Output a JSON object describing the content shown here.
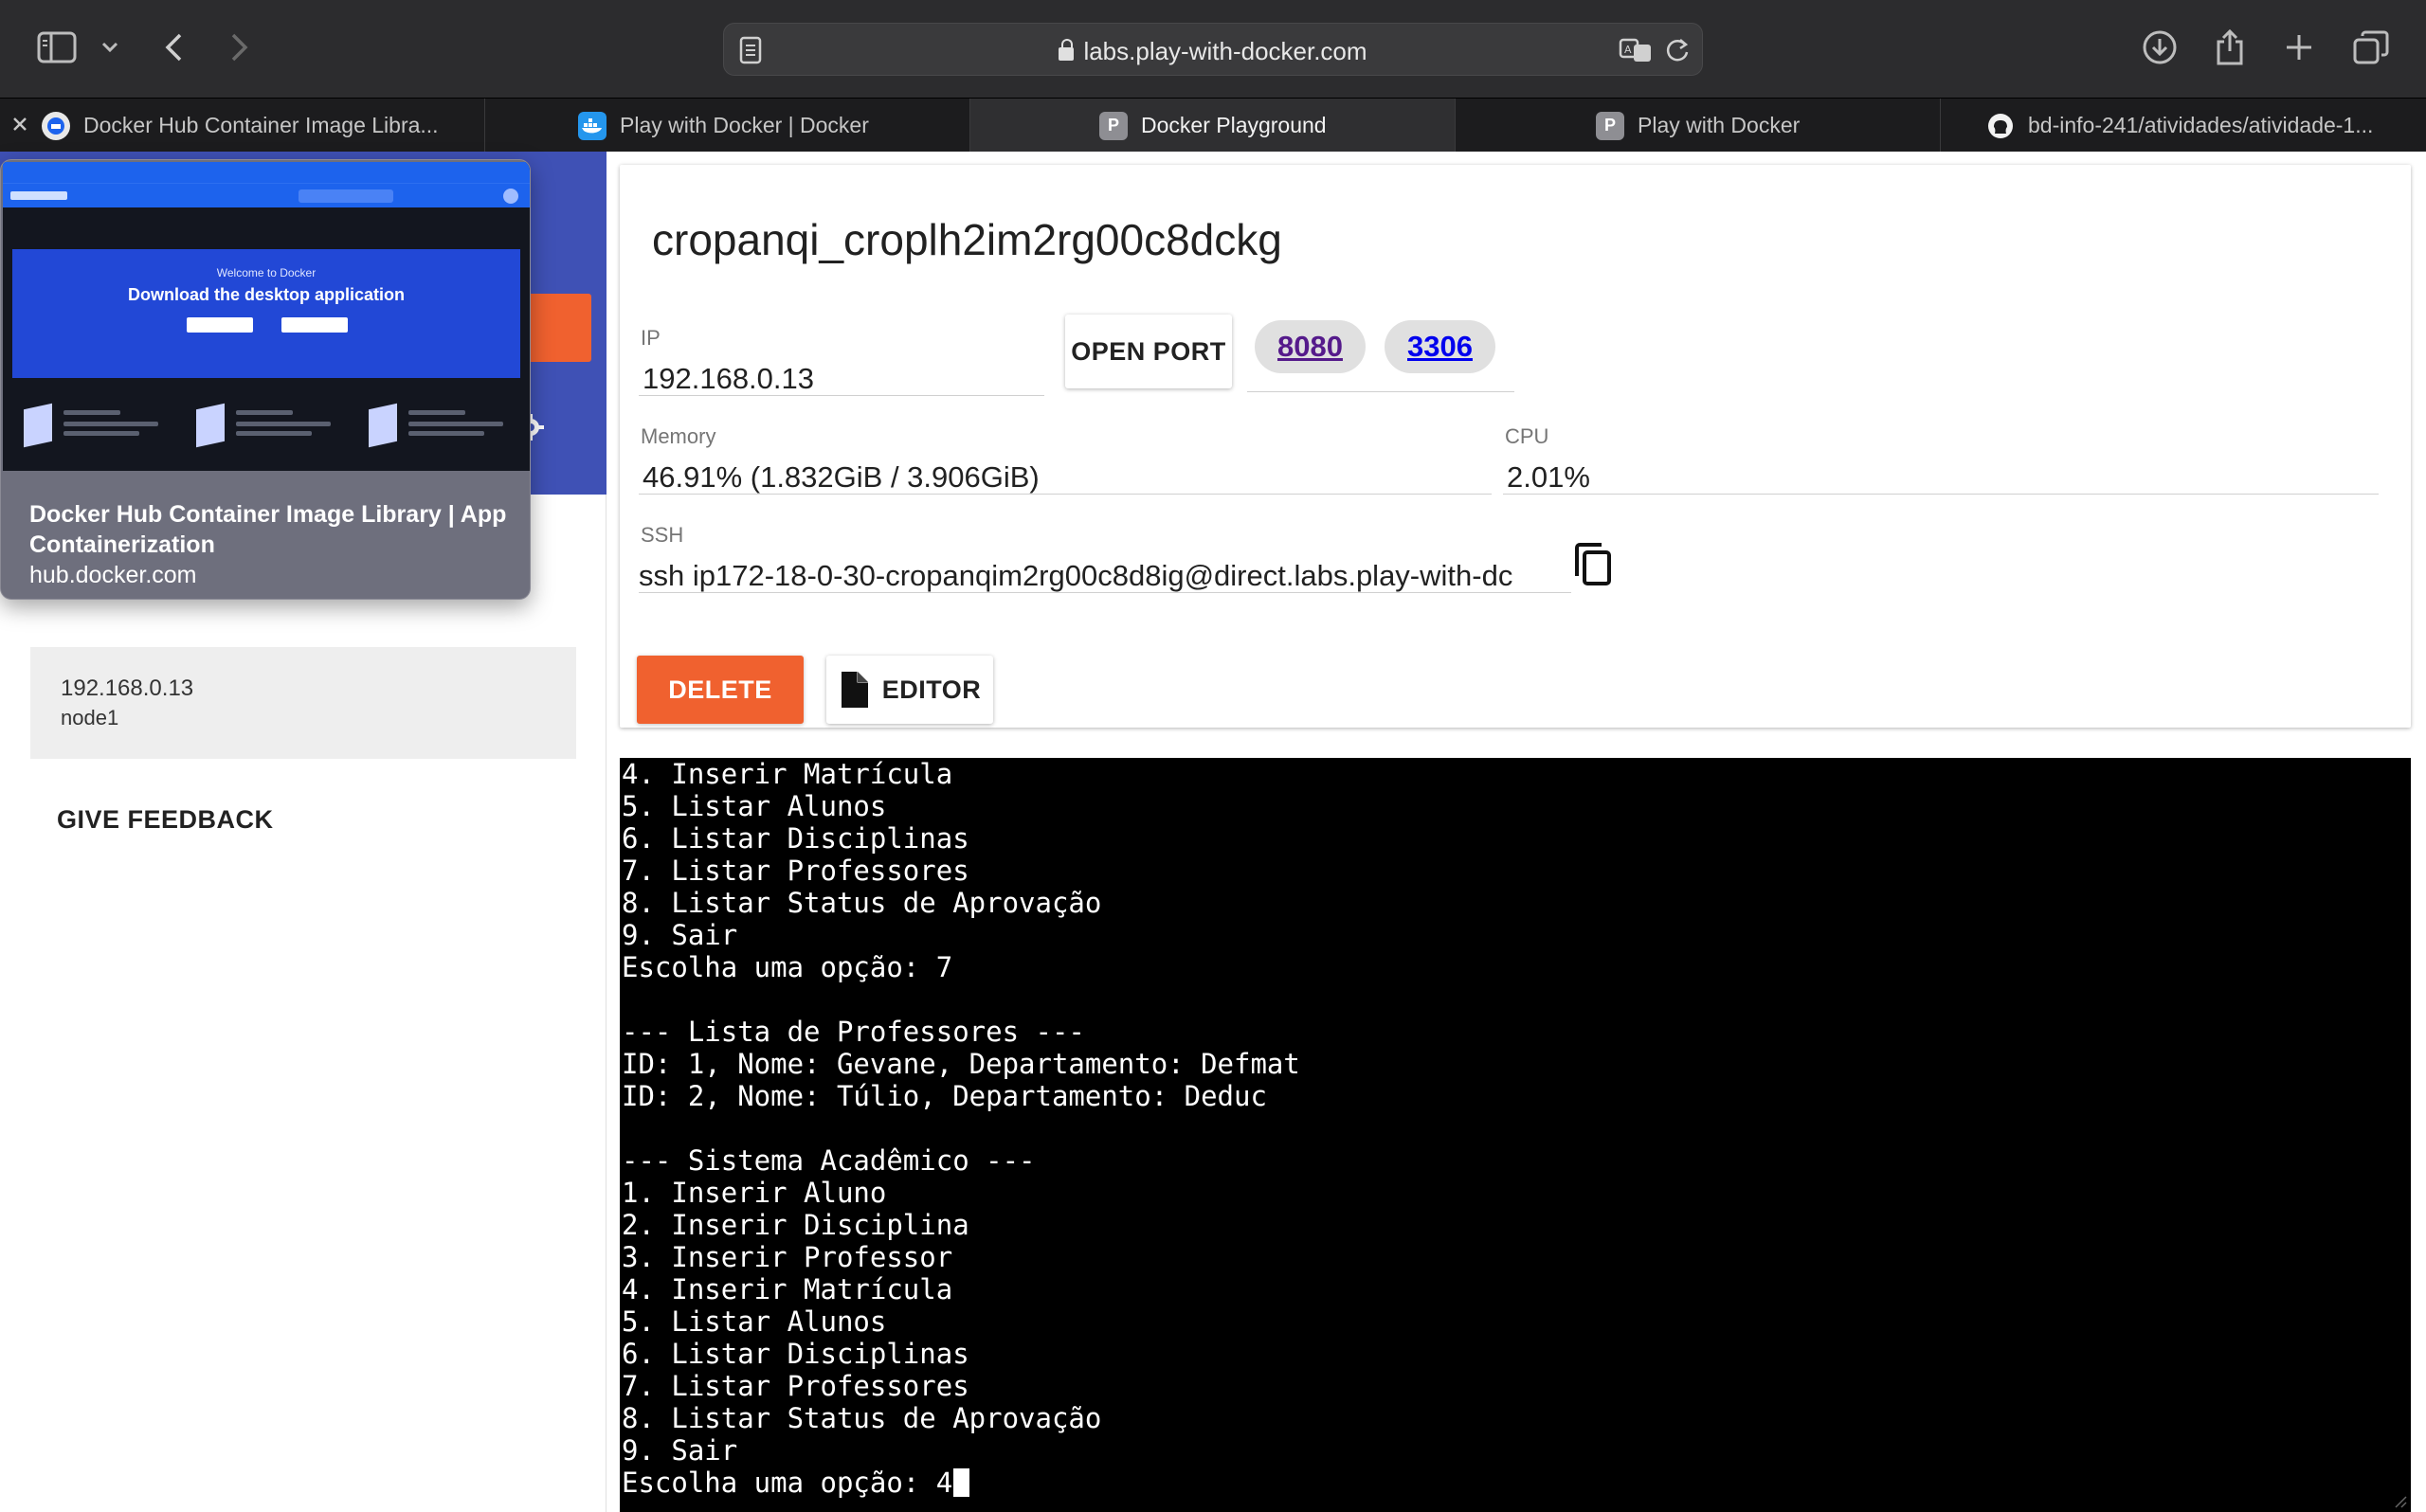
{
  "browser": {
    "url": "labs.play-with-docker.com",
    "tabs": [
      {
        "title": "Docker Hub Container Image Libra...",
        "favicon": "docker-hub-icon",
        "active": false
      },
      {
        "title": "Play with Docker | Docker",
        "favicon": "docker-whale-icon",
        "active": false
      },
      {
        "title": "Docker Playground",
        "favicon": "P",
        "active": true
      },
      {
        "title": "Play with Docker",
        "favicon": "P",
        "active": false
      },
      {
        "title": "bd-info-241/atividades/atividade-1...",
        "favicon": "github-icon",
        "active": false
      }
    ]
  },
  "hover_preview": {
    "title": "Docker Hub Container Image Library | App Containerization",
    "domain": "hub.docker.com",
    "thumbnail": {
      "welcome": "Welcome to Docker",
      "headline": "Download the desktop application"
    }
  },
  "sidebar": {
    "instance": {
      "ip": "192.168.0.13",
      "name": "node1"
    },
    "feedback_label": "GIVE FEEDBACK"
  },
  "instance_panel": {
    "hostname": "cropanqi_croplh2im2rg00c8dckg",
    "ip_label": "IP",
    "ip_value": "192.168.0.13",
    "open_port_label": "OPEN PORT",
    "ports": [
      "8080",
      "3306"
    ],
    "memory_label": "Memory",
    "memory_value": "46.91% (1.832GiB / 3.906GiB)",
    "cpu_label": "CPU",
    "cpu_value": "2.01%",
    "ssh_label": "SSH",
    "ssh_value": "ssh ip172-18-0-30-cropanqim2rg00c8d8ig@direct.labs.play-with-dc",
    "delete_label": "DELETE",
    "editor_label": "EDITOR"
  },
  "terminal": {
    "lines": [
      "4. Inserir Matrícula",
      "5. Listar Alunos",
      "6. Listar Disciplinas",
      "7. Listar Professores",
      "8. Listar Status de Aprovação",
      "9. Sair",
      "Escolha uma opção: 7",
      "",
      "--- Lista de Professores ---",
      "ID: 1, Nome: Gevane, Departamento: Defmat",
      "ID: 2, Nome: Túlio, Departamento: Deduc",
      "",
      "--- Sistema Acadêmico ---",
      "1. Inserir Aluno",
      "2. Inserir Disciplina",
      "3. Inserir Professor",
      "4. Inserir Matrícula",
      "5. Listar Alunos",
      "6. Listar Disciplinas",
      "7. Listar Professores",
      "8. Listar Status de Aprovação",
      "9. Sair",
      "Escolha uma opção: 4"
    ]
  },
  "colors": {
    "accent_orange": "#f0612f",
    "sidebar_header": "#3f51b5",
    "port_link_visited": "#551a8b",
    "port_link": "#0000ee"
  }
}
